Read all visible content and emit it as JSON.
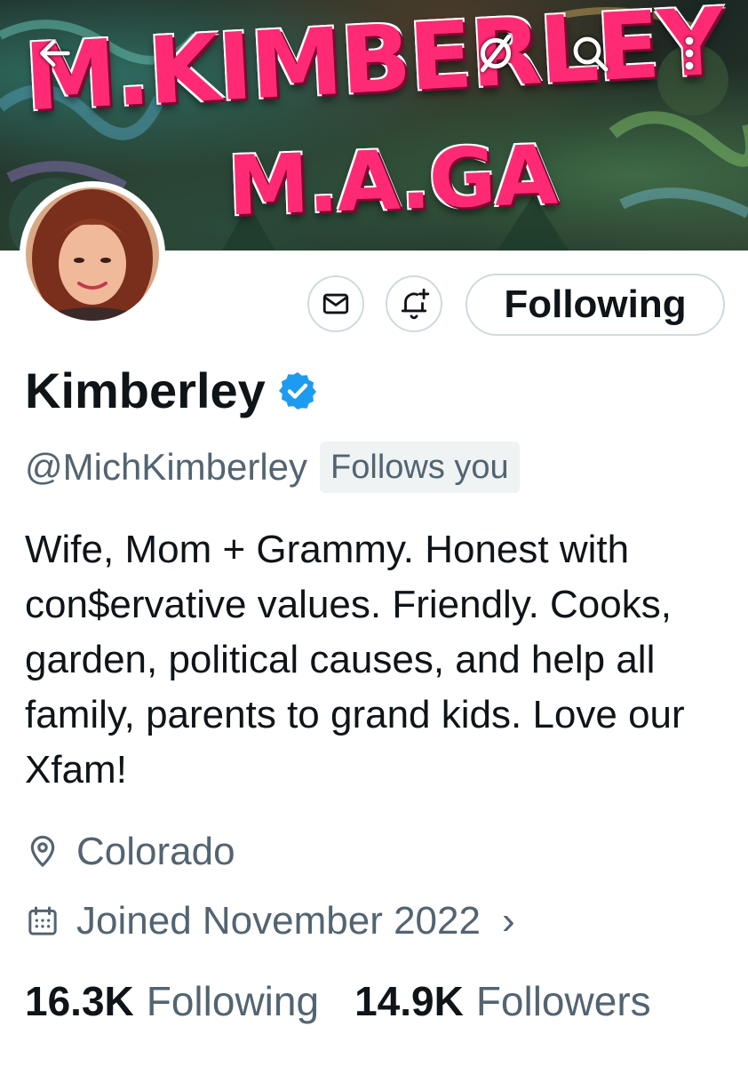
{
  "banner": {
    "title_line1": "M.KIMBERLEY",
    "title_line2": "M.A.GA"
  },
  "topbar": {
    "back_icon": "arrow-left-icon",
    "grok_icon": "grok-icon",
    "search_icon": "search-icon",
    "more_icon": "more-vertical-icon"
  },
  "actions": {
    "message_icon": "envelope-icon",
    "notify_icon": "bell-plus-icon",
    "follow_label": "Following"
  },
  "profile": {
    "name": "Kimberley",
    "verified": true,
    "handle": "@MichKimberley",
    "follows_you": "Follows you",
    "bio": "Wife, Mom + Grammy. Honest with con$ervative values. Friendly. Cooks, garden, political causes, and help all family, parents to grand kids. Love our Xfam!",
    "location": "Colorado",
    "joined": "Joined November 2022"
  },
  "stats": {
    "following_count": "16.3K",
    "following_label": "Following",
    "followers_count": "14.9K",
    "followers_label": "Followers"
  },
  "colors": {
    "accent_pink": "#ff2a73",
    "verified_blue": "#1d9bf0",
    "muted_text": "#536471",
    "border": "#cfd9de"
  }
}
